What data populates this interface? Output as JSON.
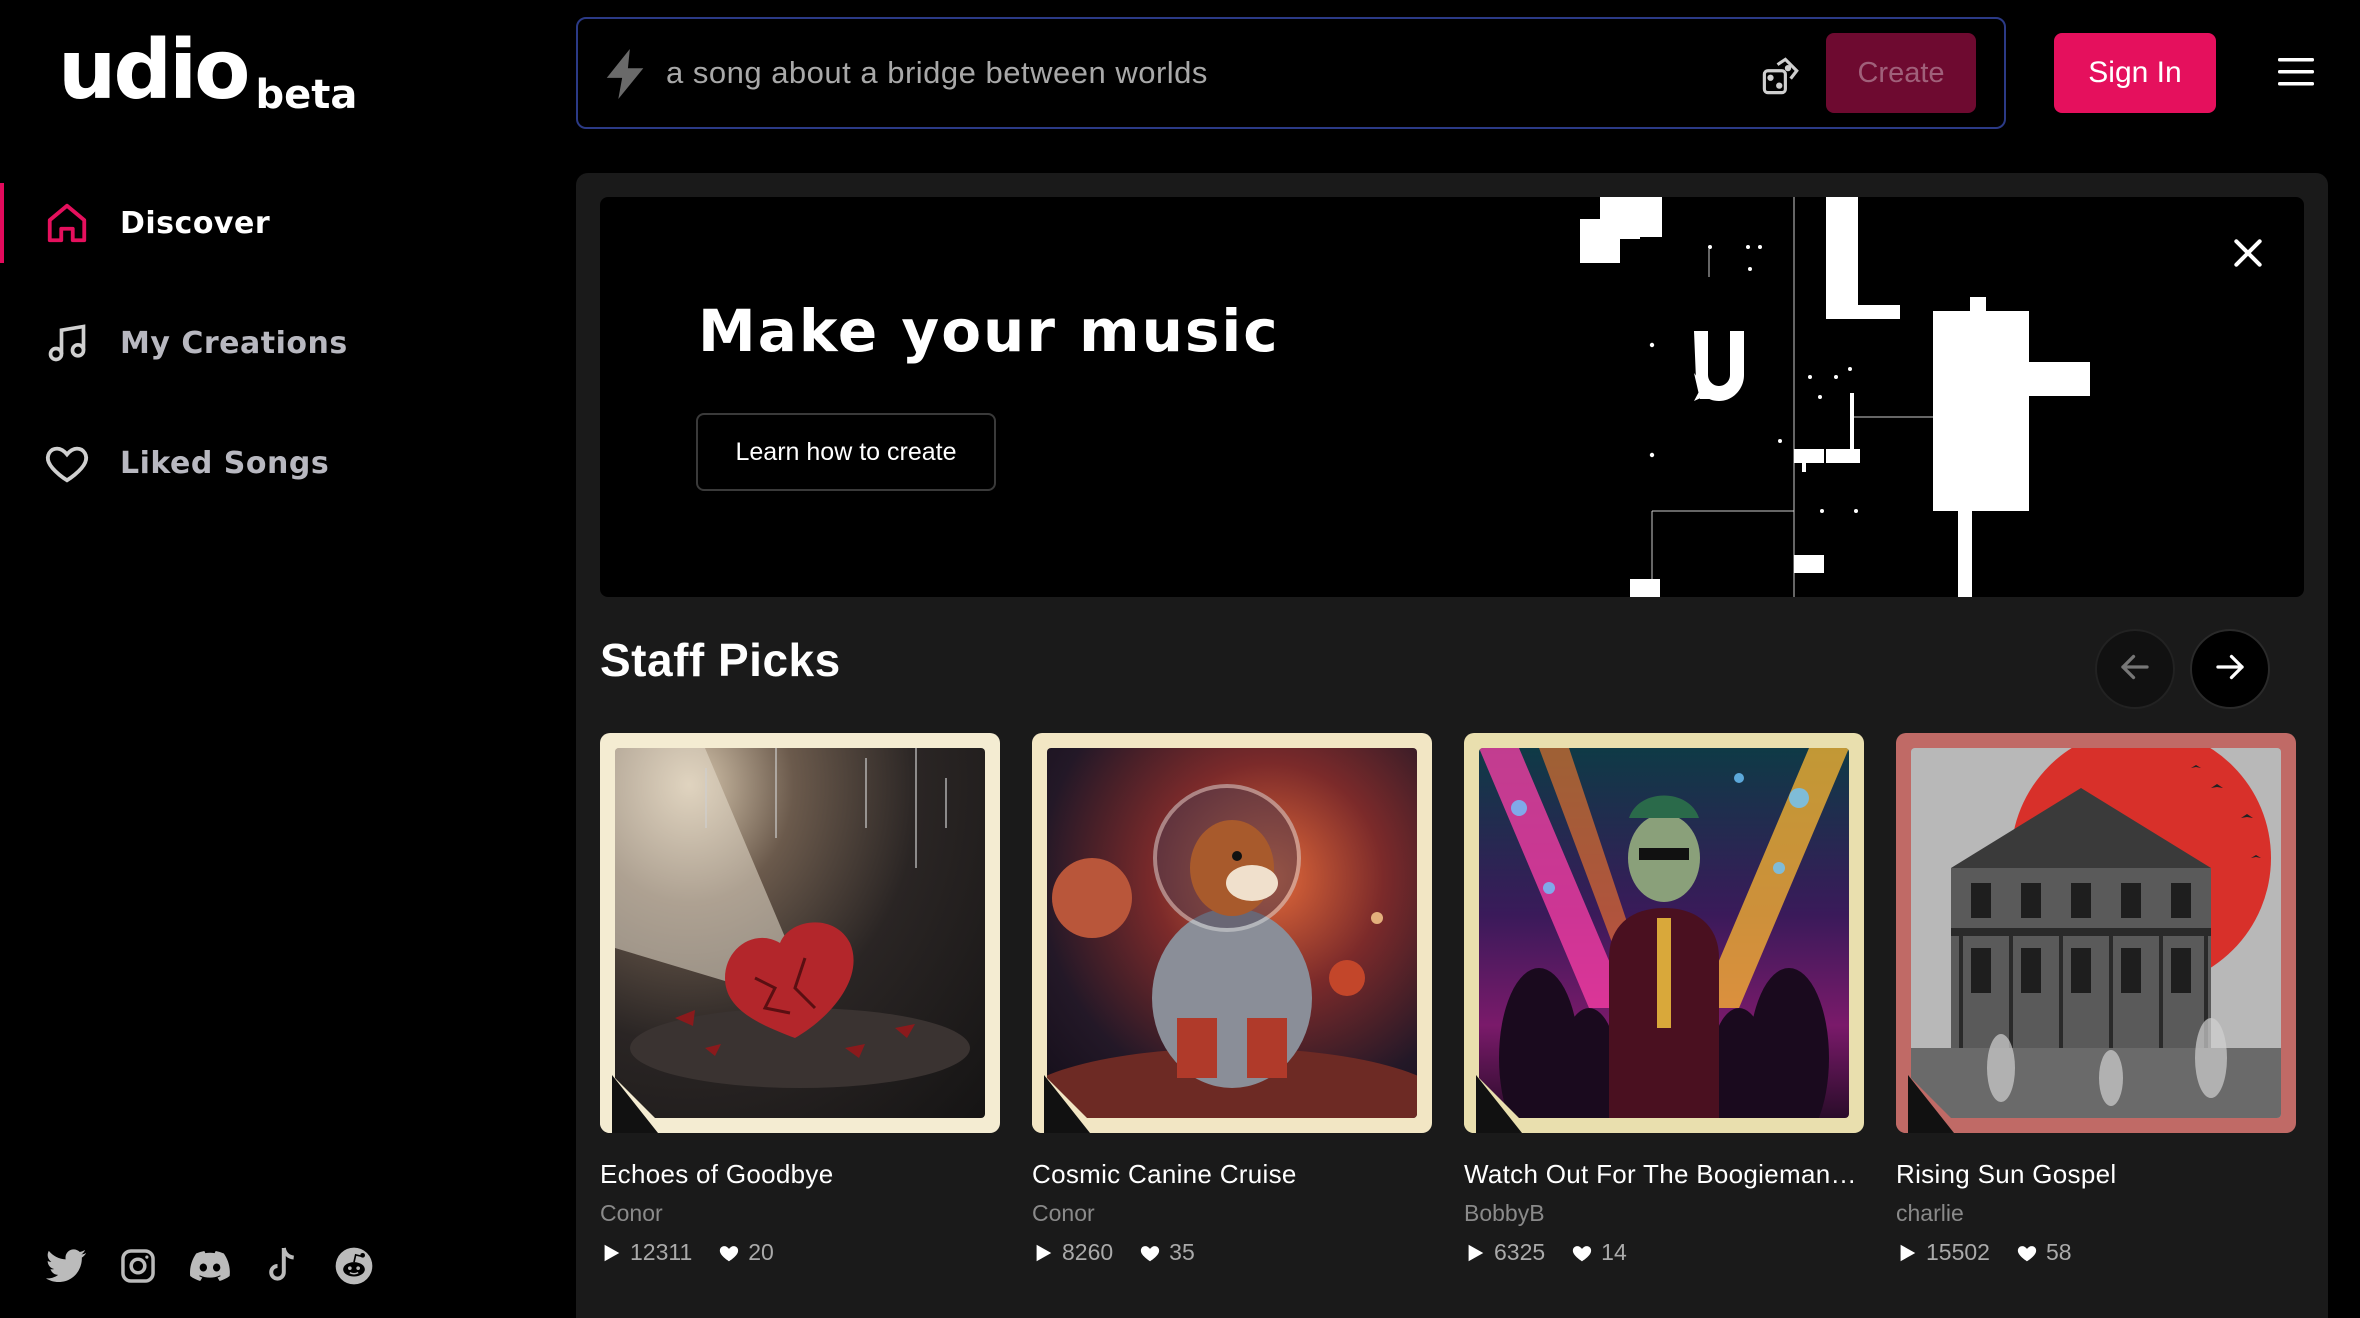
{
  "app": {
    "logo_text": "udio",
    "logo_badge": "beta"
  },
  "sidebar": {
    "items": [
      {
        "label": "Discover",
        "icon": "home-icon",
        "active": true
      },
      {
        "label": "My Creations",
        "icon": "music-note-icon",
        "active": false
      },
      {
        "label": "Liked Songs",
        "icon": "heart-icon",
        "active": false
      }
    ],
    "socials": [
      "twitter-icon",
      "instagram-icon",
      "discord-icon",
      "tiktok-icon",
      "reddit-icon"
    ]
  },
  "search": {
    "placeholder": "a song about a bridge between worlds",
    "create_label": "Create"
  },
  "header": {
    "signin_label": "Sign In"
  },
  "hero": {
    "title": "Make your music",
    "button_label": "Learn how to create"
  },
  "staff_picks": {
    "title": "Staff Picks",
    "cards": [
      {
        "title": "Echoes of Goodbye",
        "artist": "Conor",
        "plays": "12311",
        "likes": "20",
        "frame_color": "#f4ecd2"
      },
      {
        "title": "Cosmic Canine Cruise",
        "artist": "Conor",
        "plays": "8260",
        "likes": "35",
        "frame_color": "#f2e6c4"
      },
      {
        "title": "Watch Out For The Boogieman, ...",
        "artist": "BobbyB",
        "plays": "6325",
        "likes": "14",
        "frame_color": "#e9dfae"
      },
      {
        "title": "Rising Sun Gospel",
        "artist": "charlie",
        "plays": "15502",
        "likes": "58",
        "frame_color": "#c06a66"
      }
    ]
  },
  "colors": {
    "accent": "#e5105d",
    "create_button": "#6e0a30",
    "search_border": "#2b3a86",
    "panel_bg": "#1a1a1a"
  }
}
